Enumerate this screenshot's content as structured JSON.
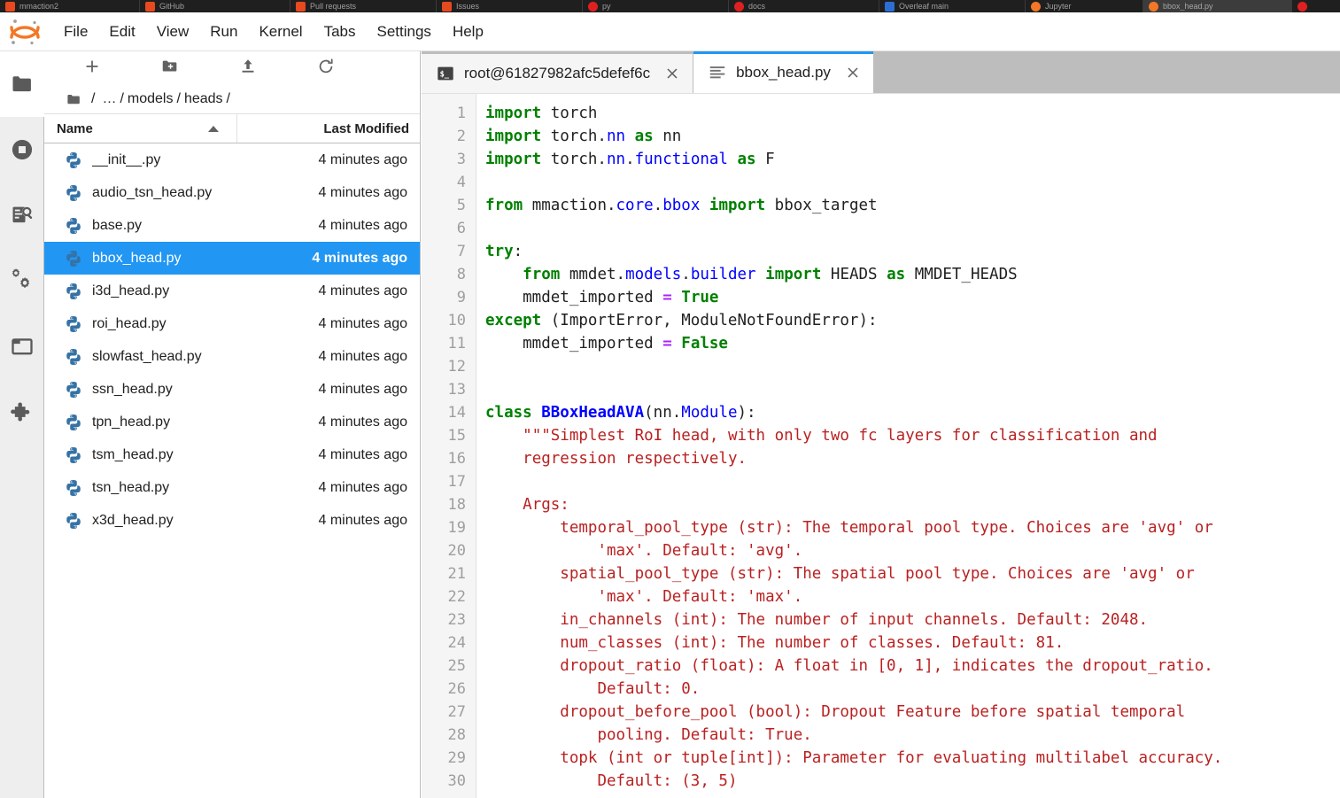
{
  "browser_tabs": [
    {
      "title": "mmaction2",
      "favicon": "orange",
      "active": false
    },
    {
      "title": "GitHub",
      "favicon": "orange",
      "active": false
    },
    {
      "title": "Pull requests",
      "favicon": "orange",
      "active": false
    },
    {
      "title": "Issues",
      "favicon": "orange",
      "active": false
    },
    {
      "title": "py",
      "favicon": "red",
      "active": false
    },
    {
      "title": "docs",
      "favicon": "red",
      "active": false
    },
    {
      "title": "Overleaf  main",
      "favicon": "blue",
      "active": false
    },
    {
      "title": "Jupyter",
      "favicon": "jup",
      "active": false
    },
    {
      "title": "bbox_head.py",
      "favicon": "jup",
      "active": true
    },
    {
      "title": "",
      "favicon": "red",
      "active": false
    }
  ],
  "menubar": {
    "logo": "jupyter-logo",
    "items": [
      {
        "label": "File"
      },
      {
        "label": "Edit"
      },
      {
        "label": "View"
      },
      {
        "label": "Run"
      },
      {
        "label": "Kernel"
      },
      {
        "label": "Tabs"
      },
      {
        "label": "Settings"
      },
      {
        "label": "Help"
      }
    ]
  },
  "activitybar": {
    "items": [
      {
        "name": "file-browser",
        "icon": "folder-icon",
        "active": true
      },
      {
        "name": "running-terminals",
        "icon": "stop-circle-icon",
        "active": false
      },
      {
        "name": "command-palette",
        "icon": "command-search-icon",
        "active": false
      },
      {
        "name": "kernels",
        "icon": "gears-icon",
        "active": false
      },
      {
        "name": "open-tabs",
        "icon": "open-tab-icon",
        "active": false
      },
      {
        "name": "extension-manager",
        "icon": "puzzle-icon",
        "active": false
      }
    ]
  },
  "filebrowser": {
    "toolbar": [
      {
        "name": "new-launcher",
        "icon": "plus-icon",
        "title": "New Launcher"
      },
      {
        "name": "new-folder",
        "icon": "new-folder-icon",
        "title": "New Folder"
      },
      {
        "name": "upload",
        "icon": "upload-icon",
        "title": "Upload Files"
      },
      {
        "name": "refresh",
        "icon": "refresh-icon",
        "title": "Refresh File List"
      }
    ],
    "breadcrumb": [
      "/",
      "…",
      "/",
      "models",
      "/",
      "heads",
      "/"
    ],
    "columns": {
      "name": "Name",
      "last_modified": "Last Modified"
    },
    "sort": {
      "column": "Name",
      "direction": "asc"
    },
    "files": [
      {
        "name": "__init__.py",
        "modified": "4 minutes ago",
        "selected": false
      },
      {
        "name": "audio_tsn_head.py",
        "modified": "4 minutes ago",
        "selected": false
      },
      {
        "name": "base.py",
        "modified": "4 minutes ago",
        "selected": false
      },
      {
        "name": "bbox_head.py",
        "modified": "4 minutes ago",
        "selected": true
      },
      {
        "name": "i3d_head.py",
        "modified": "4 minutes ago",
        "selected": false
      },
      {
        "name": "roi_head.py",
        "modified": "4 minutes ago",
        "selected": false
      },
      {
        "name": "slowfast_head.py",
        "modified": "4 minutes ago",
        "selected": false
      },
      {
        "name": "ssn_head.py",
        "modified": "4 minutes ago",
        "selected": false
      },
      {
        "name": "tpn_head.py",
        "modified": "4 minutes ago",
        "selected": false
      },
      {
        "name": "tsm_head.py",
        "modified": "4 minutes ago",
        "selected": false
      },
      {
        "name": "tsn_head.py",
        "modified": "4 minutes ago",
        "selected": false
      },
      {
        "name": "x3d_head.py",
        "modified": "4 minutes ago",
        "selected": false
      }
    ]
  },
  "dock": {
    "tabs": [
      {
        "label": "root@61827982afc5defef6c",
        "icon": "terminal-icon",
        "active": false
      },
      {
        "label": "bbox_head.py",
        "icon": "text-file-icon",
        "active": true
      }
    ]
  },
  "editor": {
    "line_numbers": [
      1,
      2,
      3,
      4,
      5,
      6,
      7,
      8,
      9,
      10,
      11,
      12,
      13,
      14,
      15,
      16,
      17,
      18,
      19,
      20,
      21,
      22,
      23,
      24,
      25,
      26,
      27,
      28,
      29,
      30
    ],
    "lines": [
      [
        {
          "t": "import",
          "c": "kw"
        },
        {
          "t": " torch",
          "c": "pl"
        }
      ],
      [
        {
          "t": "import",
          "c": "kw"
        },
        {
          "t": " torch.",
          "c": "pl"
        },
        {
          "t": "nn",
          "c": "at"
        },
        {
          "t": " ",
          "c": "pl"
        },
        {
          "t": "as",
          "c": "kw"
        },
        {
          "t": " nn",
          "c": "pl"
        }
      ],
      [
        {
          "t": "import",
          "c": "kw"
        },
        {
          "t": " torch.",
          "c": "pl"
        },
        {
          "t": "nn",
          "c": "at"
        },
        {
          "t": ".",
          "c": "pl"
        },
        {
          "t": "functional",
          "c": "at"
        },
        {
          "t": " ",
          "c": "pl"
        },
        {
          "t": "as",
          "c": "kw"
        },
        {
          "t": " F",
          "c": "pl"
        }
      ],
      [],
      [
        {
          "t": "from",
          "c": "kw"
        },
        {
          "t": " mmaction.",
          "c": "pl"
        },
        {
          "t": "core",
          "c": "at"
        },
        {
          "t": ".",
          "c": "pl"
        },
        {
          "t": "bbox",
          "c": "at"
        },
        {
          "t": " ",
          "c": "pl"
        },
        {
          "t": "import",
          "c": "kw"
        },
        {
          "t": " bbox_target",
          "c": "pl"
        }
      ],
      [],
      [
        {
          "t": "try",
          "c": "kw"
        },
        {
          "t": ":",
          "c": "pl"
        }
      ],
      [
        {
          "t": "    ",
          "c": "pl"
        },
        {
          "t": "from",
          "c": "kw"
        },
        {
          "t": " mmdet.",
          "c": "pl"
        },
        {
          "t": "models",
          "c": "at"
        },
        {
          "t": ".",
          "c": "pl"
        },
        {
          "t": "builder",
          "c": "at"
        },
        {
          "t": " ",
          "c": "pl"
        },
        {
          "t": "import",
          "c": "kw"
        },
        {
          "t": " HEADS ",
          "c": "pl"
        },
        {
          "t": "as",
          "c": "kw"
        },
        {
          "t": " MMDET_HEADS",
          "c": "pl"
        }
      ],
      [
        {
          "t": "    mmdet_imported ",
          "c": "pl"
        },
        {
          "t": "=",
          "c": "op"
        },
        {
          "t": " ",
          "c": "pl"
        },
        {
          "t": "True",
          "c": "kw"
        }
      ],
      [
        {
          "t": "except",
          "c": "kw"
        },
        {
          "t": " (ImportError, ModuleNotFoundError):",
          "c": "pl"
        }
      ],
      [
        {
          "t": "    mmdet_imported ",
          "c": "pl"
        },
        {
          "t": "=",
          "c": "op"
        },
        {
          "t": " ",
          "c": "pl"
        },
        {
          "t": "False",
          "c": "kw"
        }
      ],
      [],
      [],
      [
        {
          "t": "class",
          "c": "kw"
        },
        {
          "t": " ",
          "c": "pl"
        },
        {
          "t": "BBoxHeadAVA",
          "c": "cls"
        },
        {
          "t": "(nn.",
          "c": "pl"
        },
        {
          "t": "Module",
          "c": "at"
        },
        {
          "t": "):",
          "c": "pl"
        }
      ],
      [
        {
          "t": "    ",
          "c": "pl"
        },
        {
          "t": "\"\"\"Simplest RoI head, with only two fc layers for classification and",
          "c": "str"
        }
      ],
      [
        {
          "t": "    ",
          "c": "pl"
        },
        {
          "t": "regression respectively.",
          "c": "str"
        }
      ],
      [],
      [
        {
          "t": "    ",
          "c": "pl"
        },
        {
          "t": "Args:",
          "c": "str"
        }
      ],
      [
        {
          "t": "    ",
          "c": "pl"
        },
        {
          "t": "    temporal_pool_type (str): The temporal pool type. Choices are 'avg' or",
          "c": "str"
        }
      ],
      [
        {
          "t": "    ",
          "c": "pl"
        },
        {
          "t": "        'max'. Default: 'avg'.",
          "c": "str"
        }
      ],
      [
        {
          "t": "    ",
          "c": "pl"
        },
        {
          "t": "    spatial_pool_type (str): The spatial pool type. Choices are 'avg' or",
          "c": "str"
        }
      ],
      [
        {
          "t": "    ",
          "c": "pl"
        },
        {
          "t": "        'max'. Default: 'max'.",
          "c": "str"
        }
      ],
      [
        {
          "t": "    ",
          "c": "pl"
        },
        {
          "t": "    in_channels (int): The number of input channels. Default: 2048.",
          "c": "str"
        }
      ],
      [
        {
          "t": "    ",
          "c": "pl"
        },
        {
          "t": "    num_classes (int): The number of classes. Default: 81.",
          "c": "str"
        }
      ],
      [
        {
          "t": "    ",
          "c": "pl"
        },
        {
          "t": "    dropout_ratio (float): A float in [0, 1], indicates the dropout_ratio.",
          "c": "str"
        }
      ],
      [
        {
          "t": "    ",
          "c": "pl"
        },
        {
          "t": "        Default: 0.",
          "c": "str"
        }
      ],
      [
        {
          "t": "    ",
          "c": "pl"
        },
        {
          "t": "    dropout_before_pool (bool): Dropout Feature before spatial temporal",
          "c": "str"
        }
      ],
      [
        {
          "t": "    ",
          "c": "pl"
        },
        {
          "t": "        pooling. Default: True.",
          "c": "str"
        }
      ],
      [
        {
          "t": "    ",
          "c": "pl"
        },
        {
          "t": "    topk (int or tuple[int]): Parameter for evaluating multilabel accuracy.",
          "c": "str"
        }
      ],
      [
        {
          "t": "    ",
          "c": "pl"
        },
        {
          "t": "        Default: (3, 5)",
          "c": "str"
        }
      ]
    ]
  },
  "colors": {
    "accent": "#2196f3",
    "keyword": "#008000",
    "attribute": "#0000ff",
    "operator": "#aa22ff",
    "string": "#ba2121",
    "tabbar_bg": "#bdbdbd",
    "gutter_bg": "#f5f5f5",
    "jupyter_orange": "#f37726"
  }
}
